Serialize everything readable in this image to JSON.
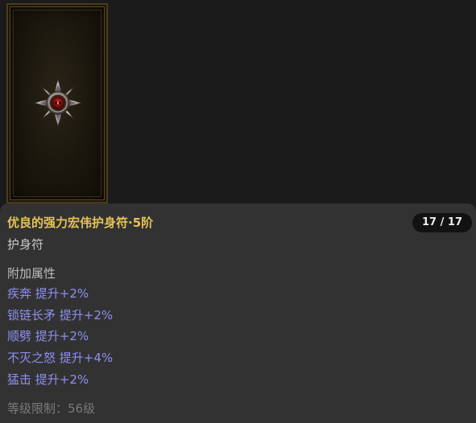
{
  "item": {
    "name": "优良的强力宏伟护身符·5阶",
    "type": "护身符",
    "count": "17 / 17",
    "icon": "amulet-icon"
  },
  "affixes": {
    "header": "附加属性",
    "lines": [
      "疾奔 提升+2%",
      "锁链长矛 提升+2%",
      "顺劈 提升+2%",
      "不灭之怒 提升+4%",
      "猛击 提升+2%"
    ]
  },
  "requirements": {
    "level_text": "等级限制：56级"
  },
  "colors": {
    "name": "#e5c158",
    "affix": "#8e8ef3",
    "panel": "#323232",
    "background": "#1b1b1b"
  }
}
